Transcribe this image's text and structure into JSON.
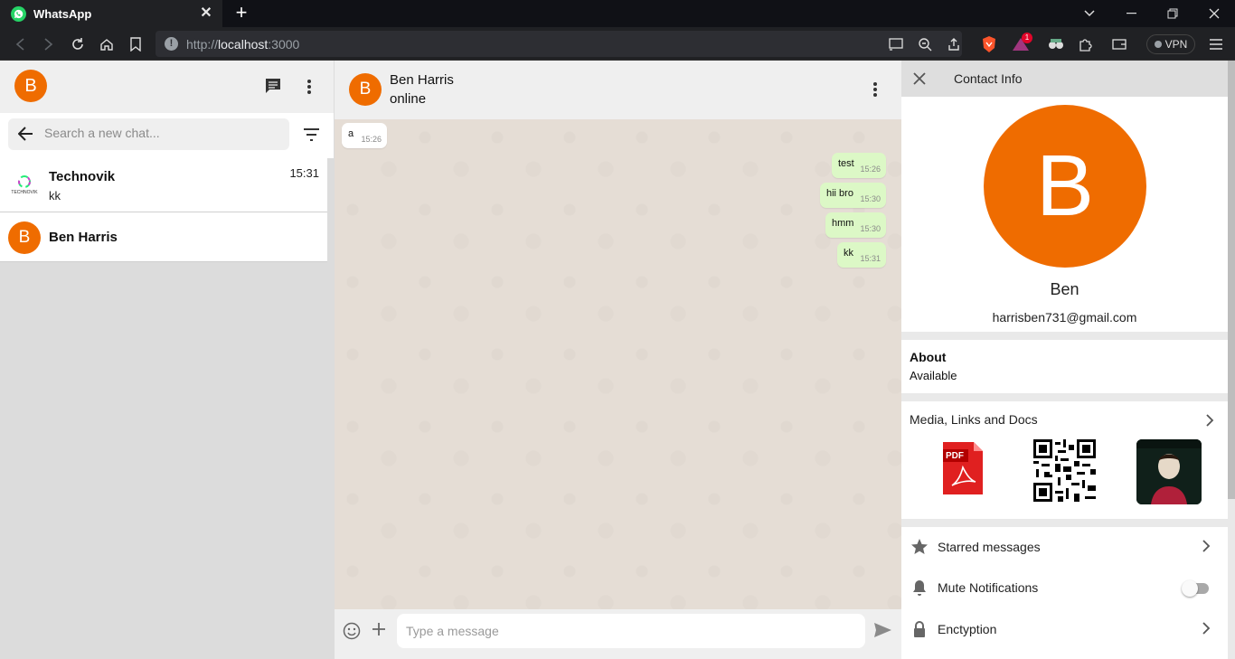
{
  "browser": {
    "tab_title": "WhatsApp",
    "url_prefix": "http://",
    "url_host": "localhost",
    "url_suffix": ":3000",
    "vpn_label": "VPN",
    "brave_badge": "1"
  },
  "sidebar": {
    "user_initial": "B",
    "search_placeholder": "Search a new chat...",
    "chats": [
      {
        "name": "Technovik",
        "last_message": "kk",
        "time": "15:31",
        "logo_text": "TECHNOVIK"
      },
      {
        "name": "Ben Harris",
        "initial": "B",
        "last_message": "",
        "time": ""
      }
    ]
  },
  "conversation": {
    "contact_initial": "B",
    "contact_name": "Ben Harris",
    "status": "online",
    "messages": [
      {
        "direction": "in",
        "text": "a",
        "time": "15:26"
      },
      {
        "direction": "out",
        "text": "test",
        "time": "15:26"
      },
      {
        "direction": "out",
        "text": "hii bro",
        "time": "15:30"
      },
      {
        "direction": "out",
        "text": "hmm",
        "time": "15:30"
      },
      {
        "direction": "out",
        "text": "kk",
        "time": "15:31"
      }
    ],
    "input_placeholder": "Type a message"
  },
  "contact_info": {
    "title": "Contact Info",
    "avatar_initial": "B",
    "name": "Ben",
    "email": "harrisben731@gmail.com",
    "about_label": "About",
    "about_value": "Available",
    "media_label": "Media, Links and Docs",
    "media_items": [
      "pdf-thumbnail",
      "qr-code-thumbnail",
      "image-thumbnail"
    ],
    "pdf_label": "PDF",
    "options": [
      {
        "label": "Starred messages",
        "icon": "star-icon"
      },
      {
        "label": "Mute Notifications",
        "icon": "bell-icon",
        "toggle": false
      },
      {
        "label": "Enctyption",
        "icon": "lock-icon"
      }
    ]
  },
  "colors": {
    "avatar": "#ef6c00",
    "bubble_out": "#dcf8c6",
    "bubble_in": "#ffffff",
    "whatsapp_green": "#25d366"
  }
}
